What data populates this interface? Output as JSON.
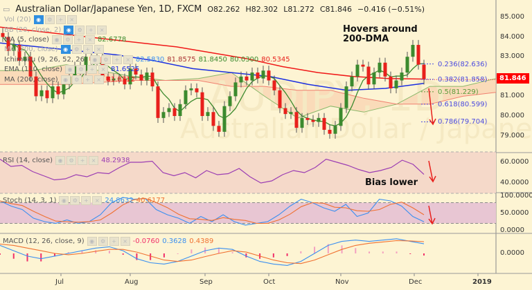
{
  "header": {
    "title": "Australian Dollar/Japanese Yen, 1D, FXCM",
    "open": "O82.262",
    "high": "H82.302",
    "low": "L81.272",
    "close": "C81.846",
    "change": "−0.416 (−0.51%)"
  },
  "watermark": {
    "symbol": "AUDJPY, 1D",
    "name": "Australian Dollar / Japanese Yen"
  },
  "legend": {
    "vol": "Vol (20)",
    "bb": "BB (20, close, 2)",
    "ma5": {
      "label": "MA (5, close)",
      "value": "82.6778"
    },
    "ma200a": "MA (200, close)",
    "ichimoku": {
      "label": "Ichimoku (9, 26, 52, 26)",
      "values": [
        "82.5830",
        "81.8575",
        "81.8450",
        "80.0300",
        "80.5345"
      ]
    },
    "ema": {
      "label": "EMA (110, close)",
      "value": "81.6525"
    },
    "ma200": {
      "label": "MA (200, close)",
      "value": "81.8712"
    },
    "rsi": {
      "label": "RSI (14, close)",
      "value": "48.2938"
    },
    "stoch": {
      "label": "Stoch (14, 3, 1)",
      "k": "24.8632",
      "d": "40.6177"
    },
    "macd": {
      "label": "MACD (12, 26, close, 9)",
      "hist": "-0.0760",
      "macd": "0.3628",
      "signal": "0.4389"
    }
  },
  "annotations": {
    "hovers": [
      "Hovers around",
      "200-DMA"
    ],
    "bias": "Bias lower"
  },
  "fib_levels": [
    {
      "label": "0.236(82.636)",
      "price": 82.636,
      "color": "#4a4adf"
    },
    {
      "label": "0.382(81.858)",
      "price": 81.858,
      "color": "#4a4adf"
    },
    {
      "label": "0.5(81.229)",
      "price": 81.229,
      "color": "#5a9a3a"
    },
    {
      "label": "0.618(80.599)",
      "price": 80.599,
      "color": "#4a4adf"
    },
    {
      "label": "0.786(79.704)",
      "price": 79.704,
      "color": "#4a4adf"
    }
  ],
  "last_price": "81.846",
  "colors": {
    "up": "#3c8a2e",
    "down": "#e8201c",
    "ma200": "#f01818",
    "ema": "#1a2ee0",
    "ma5": "#3c8a2e",
    "rsi": "#9b3db3",
    "stoch_k": "#3a8ff0",
    "stoch_d": "#f07030",
    "background": "#fdf4d3"
  },
  "chart_data": [
    {
      "type": "candlestick",
      "title": "Australian Dollar/Japanese Yen, 1D, FXCM",
      "ylim": [
        78.3,
        85.5
      ],
      "yticks": [
        "85.000",
        "84.000",
        "83.000",
        "81.000",
        "80.000",
        "79.000"
      ],
      "xticks": [
        "Jul",
        "Aug",
        "Sep",
        "Oct",
        "Nov",
        "Dec",
        "2019"
      ],
      "closes": [
        84.0,
        83.3,
        83.6,
        82.8,
        83.0,
        82.0,
        81.0,
        81.3,
        80.9,
        81.5,
        81.1,
        81.6,
        82.0,
        82.5,
        82.3,
        83.0,
        82.8,
        83.0,
        82.0,
        81.8,
        81.9,
        81.9,
        81.6,
        82.4,
        82.1,
        81.8,
        82.2,
        81.5,
        79.9,
        80.2,
        80.4,
        80.0,
        80.6,
        81.3,
        81.4,
        81.2,
        80.0,
        80.2,
        79.5,
        79.2,
        80.5,
        81.0,
        81.7,
        82.0,
        81.8,
        82.2,
        81.9,
        82.3,
        81.8,
        81.3,
        80.4,
        80.1,
        80.2,
        79.4,
        79.9,
        79.8,
        79.7,
        79.9,
        79.3,
        79.1,
        79.5,
        80.4,
        81.5,
        82.0,
        82.6,
        82.5,
        81.6,
        82.2,
        82.7,
        82.0,
        81.4,
        81.8,
        82.2,
        83.0,
        83.6,
        82.6,
        81.846
      ],
      "ma200": [
        84.5,
        84.3,
        84.1,
        83.9,
        83.7,
        83.5,
        83.2,
        82.9,
        82.5,
        82.2,
        82.0,
        81.9,
        81.87
      ],
      "ema110": [
        83.7,
        83.5,
        83.3,
        83.1,
        82.8,
        82.4,
        82.2,
        82.0,
        81.6,
        81.3,
        81.4,
        81.65
      ],
      "cloud_span_a": [
        82.3,
        82.3,
        82.6,
        82.3,
        82.0,
        81.8,
        81.9,
        82.2,
        81.0,
        79.9,
        80.5,
        80.2,
        80.6,
        81.5,
        81.5,
        81.9
      ],
      "cloud_span_b": [
        81.6,
        81.6,
        81.6,
        81.7,
        81.8,
        81.8,
        81.8,
        81.5,
        81.5,
        81.3,
        81.3,
        80.9,
        80.6,
        80.6,
        81.0,
        81.2
      ]
    },
    {
      "type": "line",
      "title": "RSI (14, close)",
      "ylim": [
        32,
        68
      ],
      "yticks": [
        "60.0000",
        "40.0000"
      ],
      "bands": [
        30,
        70
      ],
      "values": [
        63,
        56,
        57,
        51,
        47,
        43,
        44,
        48,
        46,
        50,
        49,
        55,
        60,
        60,
        61,
        50,
        47,
        50,
        45,
        52,
        48,
        49,
        54,
        46,
        40,
        42,
        48,
        52,
        50,
        55,
        63,
        60,
        57,
        53,
        50,
        52,
        55,
        62,
        58,
        48.29
      ]
    },
    {
      "type": "line",
      "title": "Stoch (14, 3, 1)",
      "ylim": [
        -5,
        105
      ],
      "yticks": [
        "100.0000",
        "50.0000",
        "0.0000"
      ],
      "bands": [
        20,
        80
      ],
      "k": [
        85,
        70,
        60,
        35,
        25,
        20,
        30,
        20,
        25,
        45,
        80,
        95,
        90,
        92,
        60,
        45,
        35,
        20,
        40,
        25,
        45,
        25,
        15,
        20,
        25,
        45,
        70,
        90,
        80,
        65,
        55,
        75,
        40,
        50,
        90,
        85,
        70,
        40,
        24.86
      ]
    },
    {
      "type": "line",
      "title": "MACD (12, 26, close, 9)",
      "ylim": [
        -0.7,
        0.7
      ],
      "yticks": [
        "0.0000"
      ],
      "macd": [
        0.3,
        0.1,
        -0.1,
        -0.2,
        -0.1,
        0.0,
        0.1,
        0.2,
        0.25,
        0.1,
        -0.2,
        -0.35,
        -0.4,
        -0.3,
        -0.1,
        0.1,
        0.2,
        0.15,
        -0.1,
        -0.3,
        -0.4,
        -0.45,
        -0.3,
        0.0,
        0.3,
        0.45,
        0.5,
        0.45,
        0.5,
        0.55,
        0.45,
        0.36
      ],
      "signal": [
        0.35,
        0.3,
        0.2,
        0.1,
        0.0,
        -0.05,
        0.0,
        0.08,
        0.15,
        0.15,
        0.05,
        -0.1,
        -0.25,
        -0.3,
        -0.25,
        -0.12,
        0.0,
        0.1,
        0.05,
        -0.1,
        -0.25,
        -0.35,
        -0.38,
        -0.25,
        -0.05,
        0.15,
        0.3,
        0.38,
        0.43,
        0.48,
        0.47,
        0.44
      ]
    }
  ]
}
